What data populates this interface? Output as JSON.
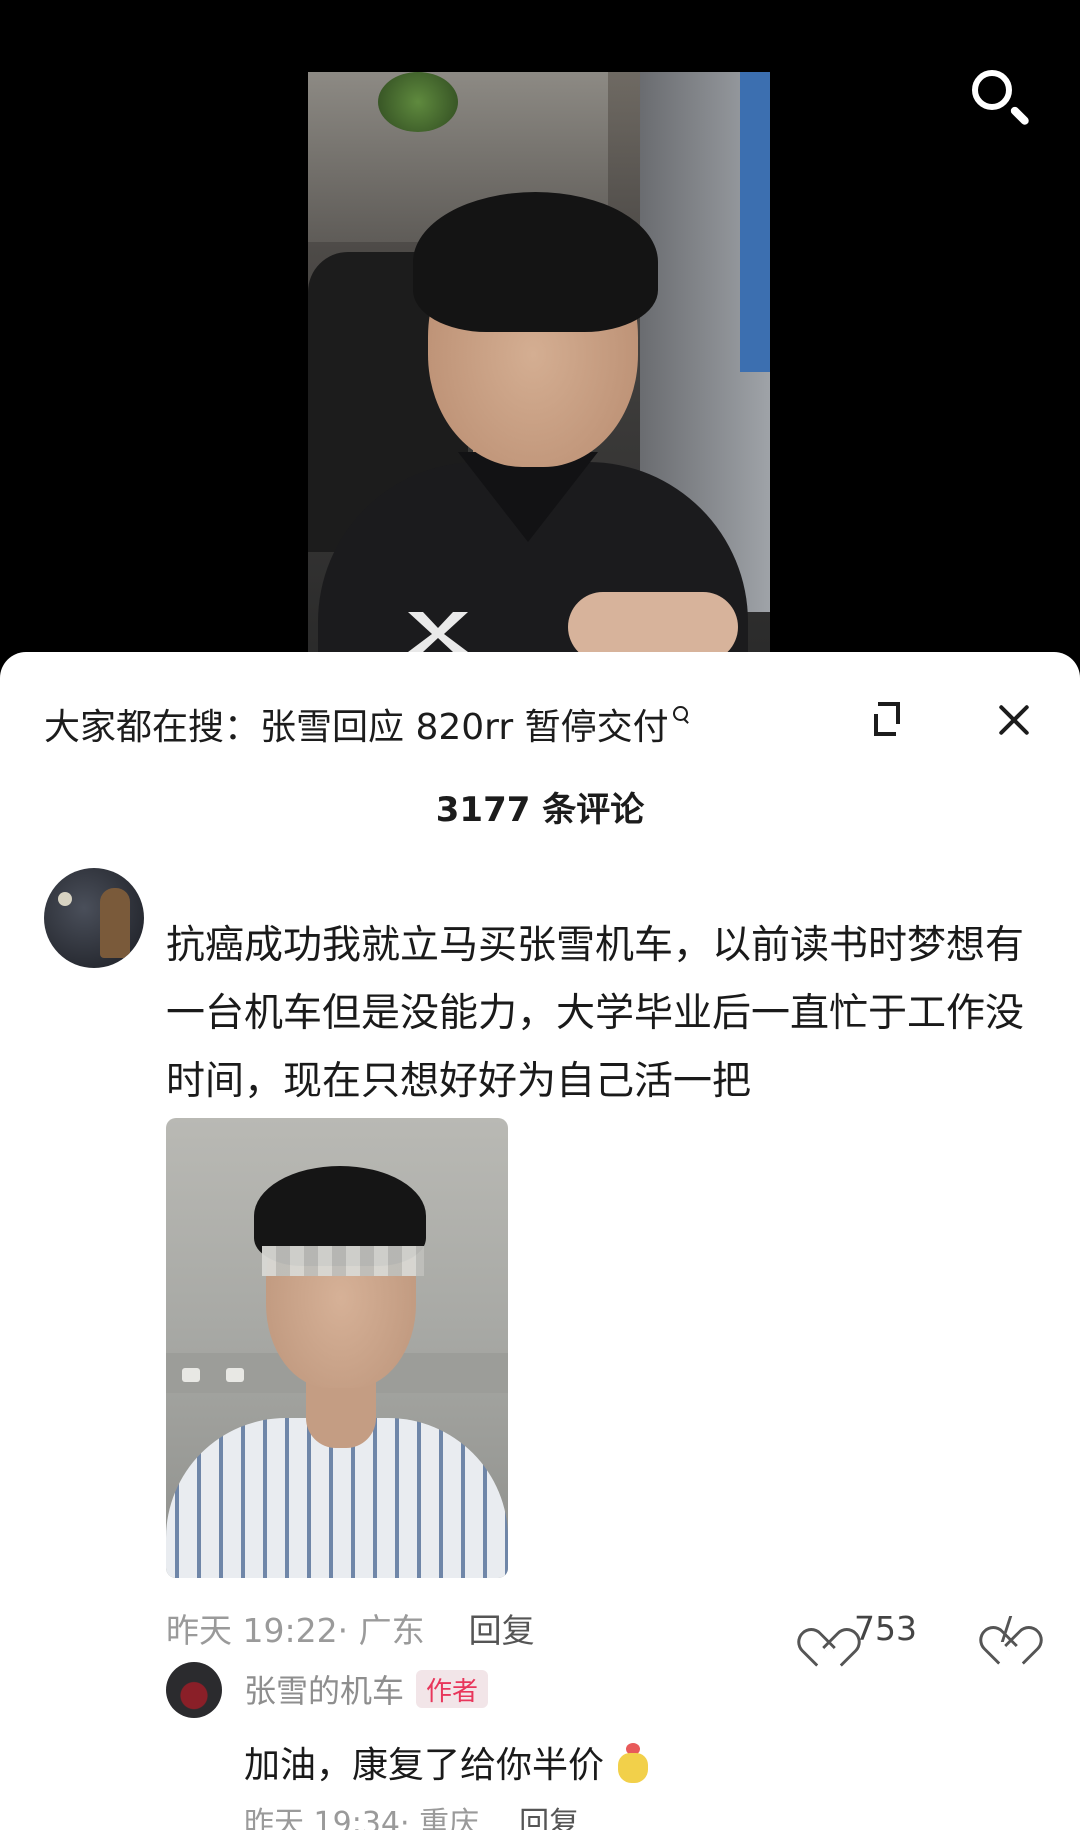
{
  "video": {
    "search_icon": "search-icon"
  },
  "sheet": {
    "suggestion_prefix": "大家都在搜：",
    "suggestion_query": "张雪回应 820rr 暂停交付",
    "collapse_icon": "collapse-icon",
    "close_icon": "close-icon",
    "comment_count": "3177 条评论"
  },
  "comments": [
    {
      "text": "抗癌成功我就立马买张雪机车，以前读书时梦想有一台机车但是没能力，大学毕业后一直忙于工作没时间，现在只想好好为自己活一把",
      "time": "昨天 19:22",
      "location": "· 广东",
      "reply_label": "回复",
      "likes": "753",
      "reply": {
        "author": "张雪的机车",
        "badge": "作者",
        "text": "加油，康复了给你半价",
        "time": "昨天 19:34",
        "location": "· 重庆",
        "reply_label": "回复"
      }
    }
  ]
}
